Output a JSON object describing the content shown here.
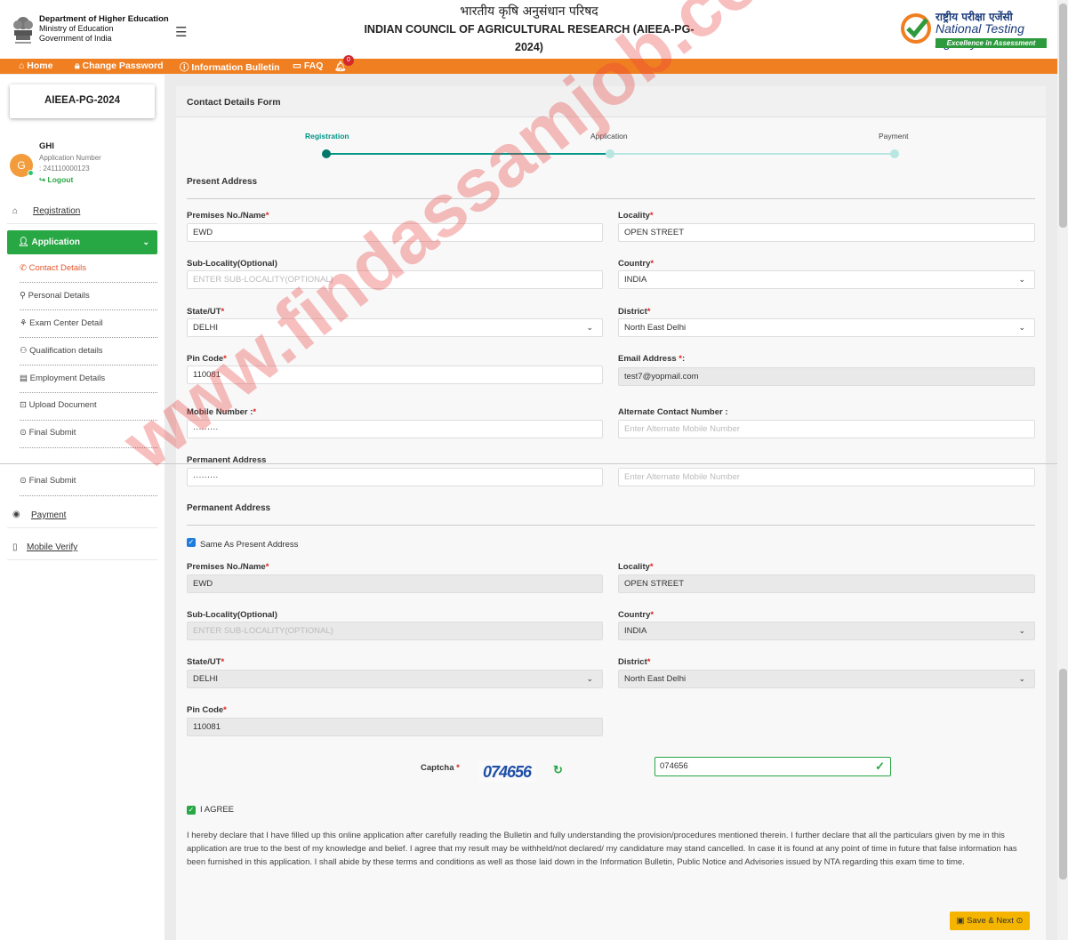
{
  "header": {
    "dept_name": "Department of Higher Education",
    "ministry": "Ministry of Education",
    "govt": "Government of India",
    "title_hindi": "भारतीय कृषि अनुसंधान परिषद",
    "title_line1": "INDIAN COUNCIL OF AGRICULTURAL RESEARCH (AIEEA-PG-",
    "title_line2": "2024)",
    "nta_hindi": "राष्ट्रीय परीक्षा एजेंसी",
    "nta_english": "National Testing Agency",
    "nta_tagline": "Excellence in Assessment"
  },
  "nav": {
    "home": "Home",
    "change_password": "Change Password",
    "information_bulletin": "Information Bulletin",
    "faq": "FAQ",
    "notification_count": "0"
  },
  "sidebar": {
    "exam_title": "AIEEA-PG-2024",
    "user_initial": "G",
    "user_name": "GHI",
    "application_number_label": "Application Number",
    "application_number": ": 241110000123",
    "logout": "Logout",
    "registration": "Registration",
    "application": "Application",
    "sub_items": [
      "Contact Details",
      "Personal Details",
      "Exam Center Detail",
      "Qualification details",
      "Employment Details",
      "Upload Document",
      "Final Submit",
      "Final Submit"
    ],
    "payment": "Payment",
    "mobile_verify": "Mobile Verify"
  },
  "form": {
    "title": "Contact Details Form",
    "steps": [
      "Registration",
      "Application",
      "Payment"
    ],
    "present_address_title": "Present Address",
    "permanent_address_title": "Permanent Address",
    "labels": {
      "premises": "Premises No./Name",
      "locality": "Locality",
      "sub_locality": "Sub-Locality(Optional)",
      "country": "Country",
      "state": "State/UT",
      "district": "District",
      "pin_code": "Pin Code",
      "email": "Email Address ",
      "email_suffix": ":",
      "mobile": "Mobile Number :",
      "alternate": "Alternate Contact Number :",
      "required_mark": "*"
    },
    "present": {
      "premises": "EWD",
      "locality": "OPEN STREET",
      "sub_locality_placeholder": "ENTER SUB-LOCALITY(OPTIONAL)",
      "country": "INDIA",
      "state": "DELHI",
      "district": "North East Delhi",
      "pin_code": "110081",
      "email": "test7@yopmail.com",
      "mobile_masked": "·········",
      "alternate_placeholder": "Enter Alternate Mobile Number"
    },
    "same_as_present": "Same As Present Address",
    "permanent": {
      "premises": "EWD",
      "locality": "OPEN STREET",
      "sub_locality_placeholder": "ENTER SUB-LOCALITY(OPTIONAL)",
      "country": "INDIA",
      "state": "DELHI",
      "district": "North East Delhi",
      "pin_code": "110081"
    },
    "captcha_label": "Captcha",
    "captcha_image_text": "074656",
    "captcha_value": "074656",
    "agree_label": "I AGREE",
    "declaration": "I hereby declare that I have filled up this online application after carefully reading the Bulletin and fully understanding the provision/procedures mentioned therein. I further declare that all the particulars given by me in this application are true to the best of my knowledge and belief. I agree that my result may be withheld/not declared/ my candidature may stand cancelled. In case it is found at any point of time in future that false information has been furnished in this application. I shall abide by these terms and conditions as well as those laid down in the Information Bulletin, Public Notice and Advisories issued by NTA regarding this exam time to time.",
    "save_next": "Save & Next"
  },
  "watermark": "www.findassamjob.com",
  "colors": {
    "orange_bar": "#f07f22",
    "active_green": "#28a745",
    "step_teal": "#009688",
    "required_red": "#e02020",
    "save_yellow": "#f4b400"
  }
}
